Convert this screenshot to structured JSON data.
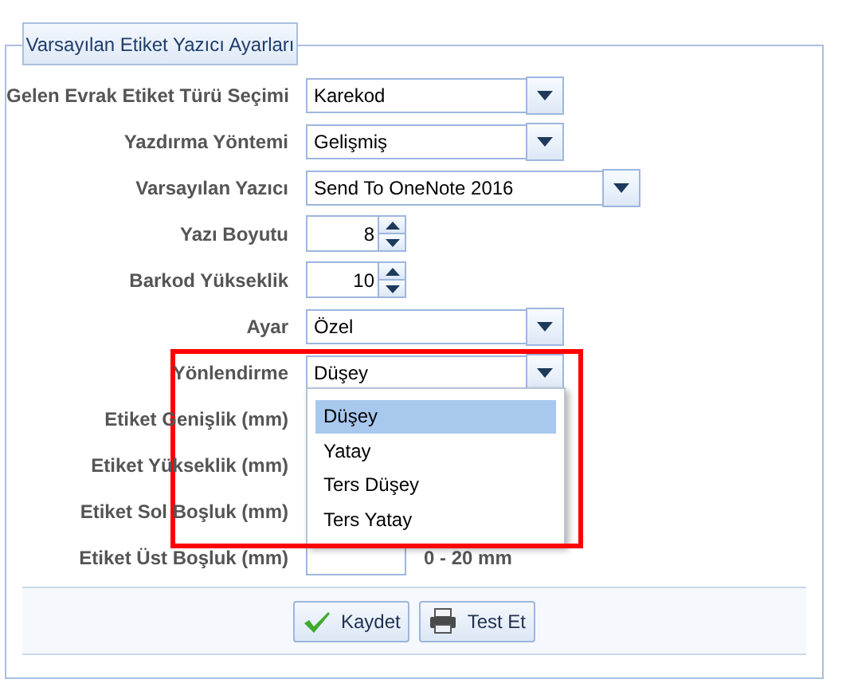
{
  "panel": {
    "title": "Varsayılan Etiket Yazıcı Ayarları"
  },
  "fields": [
    {
      "kind": "select",
      "label": "Gelen Evrak Etiket Türü Seçimi",
      "value": "Karekod"
    },
    {
      "kind": "select",
      "label": "Yazdırma Yöntemi",
      "value": "Gelişmiş"
    },
    {
      "kind": "wide_select",
      "label": "Varsayılan Yazıcı",
      "value": "Send To OneNote 2016"
    },
    {
      "kind": "spinner",
      "label": "Yazı Boyutu",
      "value": "8"
    },
    {
      "kind": "spinner",
      "label": "Barkod Yükseklik",
      "value": "10"
    },
    {
      "kind": "select",
      "label": "Ayar",
      "value": "Özel"
    },
    {
      "kind": "select",
      "label": "Yönlendirme",
      "value": "Düşey",
      "expanded": true
    },
    {
      "kind": "covered",
      "label": "Etiket Genişlik (mm)"
    },
    {
      "kind": "covered",
      "label": "Etiket Yükseklik (mm)"
    },
    {
      "kind": "covered",
      "label": "Etiket Sol Boşluk (mm)"
    },
    {
      "kind": "text",
      "label": "Etiket Üst Boşluk (mm)",
      "hint": "0 - 20 mm"
    }
  ],
  "dropdown": {
    "options": [
      {
        "label": "Düşey",
        "selected": true
      },
      {
        "label": "Yatay",
        "selected": false
      },
      {
        "label": "Ters Düşey",
        "selected": false
      },
      {
        "label": "Ters Yatay",
        "selected": false
      }
    ]
  },
  "buttons": [
    {
      "kind": "save",
      "label": "Kaydet"
    },
    {
      "kind": "print",
      "label": "Test Et"
    }
  ]
}
